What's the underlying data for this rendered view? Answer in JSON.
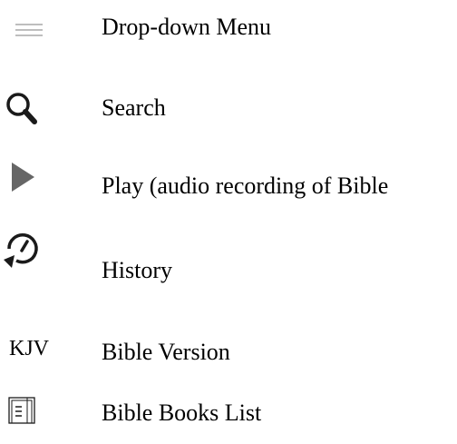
{
  "legend": {
    "items": [
      {
        "icon": "hamburger-menu-icon",
        "label": "Drop-down Menu"
      },
      {
        "icon": "search-icon",
        "label": "Search"
      },
      {
        "icon": "play-icon",
        "label": "Play (audio recording of Bible"
      },
      {
        "icon": "history-icon",
        "label": "History"
      },
      {
        "icon": "kjv-version-label",
        "icon_text": "KJV",
        "label": "Bible Version"
      },
      {
        "icon": "book-list-icon",
        "label": "Bible Books List"
      }
    ]
  },
  "colors": {
    "menu_lines": "#a8a8a8",
    "play": "#666666",
    "icon_dark": "#1a1a1a",
    "text": "#000000"
  }
}
